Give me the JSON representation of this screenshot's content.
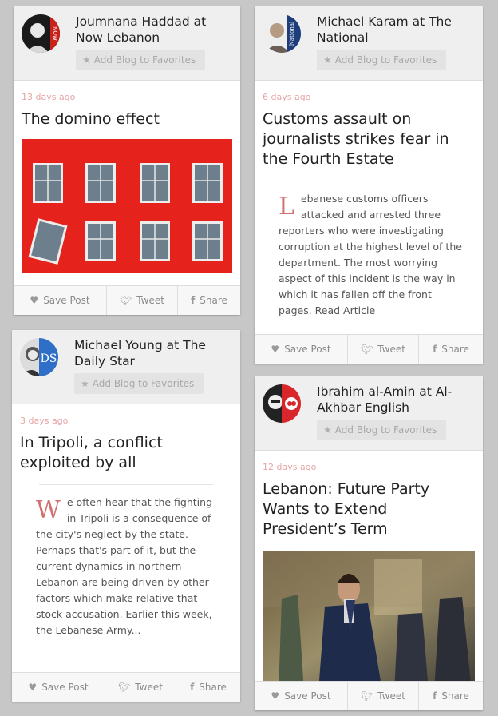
{
  "common": {
    "fav_label": "Add Blog to Favorites",
    "save_label": "Save Post",
    "tweet_label": "Tweet",
    "share_label": "Share"
  },
  "cards": [
    {
      "author": "Joumnana Haddad at Now Lebanon",
      "time": "13 days ago",
      "title": "The domino effect",
      "avatar_badge": "NOW"
    },
    {
      "author": "Michael Karam at The National",
      "time": "6 days ago",
      "title": "Customs assault on journalists strikes fear in the Fourth Estate",
      "dropcap": "L",
      "excerpt": "ebanese customs officers attacked and arrested three reporters who were investigating corruption at the highest level of the department. The most worrying aspect of this incident is the way in which it has fallen off the front pages. Read Article",
      "avatar_badge": "National"
    },
    {
      "author": "Michael Young at The Daily Star",
      "time": "3 days ago",
      "title": "In Tripoli, a conflict exploited by all",
      "dropcap": "W",
      "excerpt": "e often hear that the fighting in Tripoli is a consequence of the city's neglect by the state. Perhaps that's part of it, but the current dynamics in northern Lebanon are being driven by other factors which make relative that stock accusation. Earlier this week, the Lebanese Army...",
      "avatar_badge": "DS"
    },
    {
      "author": "Ibrahim al-Amin at Al-Akhbar English",
      "time": "12 days ago",
      "title": "Lebanon: Future Party Wants to Extend President’s Term",
      "avatar_badge": ""
    }
  ],
  "colors": {
    "accent": "#d36f6f",
    "background": "#c7c7c7",
    "photo_red": "#e5231c"
  }
}
